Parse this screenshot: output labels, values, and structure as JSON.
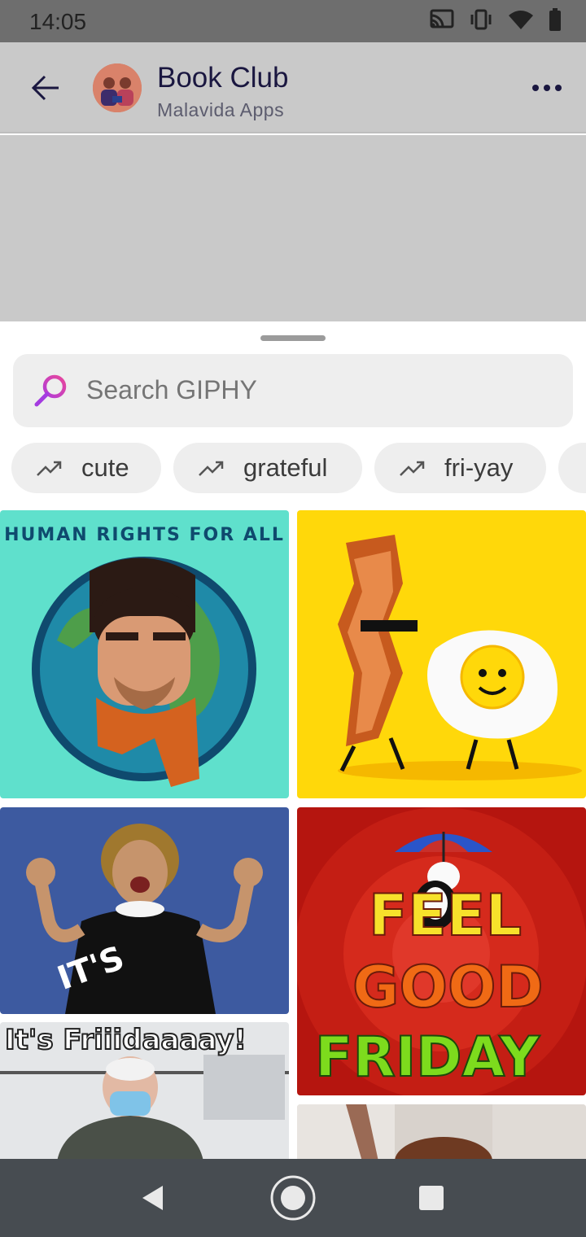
{
  "status_bar": {
    "time": "14:05",
    "icons": [
      "cast-icon",
      "vibrate-icon",
      "wifi-icon",
      "battery-icon"
    ]
  },
  "header": {
    "back_icon": "arrow-left-icon",
    "avatar": "group-avatar",
    "title": "Book Club",
    "subtitle": "Malavida Apps",
    "more_icon": "more-vertical-icon"
  },
  "giphy": {
    "search": {
      "placeholder": "Search GIPHY",
      "icon": "search-icon"
    },
    "trending_chips": [
      {
        "label": "cute",
        "icon": "trending-icon"
      },
      {
        "label": "grateful",
        "icon": "trending-icon"
      },
      {
        "label": "fri-yay",
        "icon": "trending-icon"
      }
    ],
    "gifs": [
      {
        "name": "human-rights-gif",
        "text": "HUMAN RIGHTS FOR ALL"
      },
      {
        "name": "bacon-egg-gif",
        "text": ""
      },
      {
        "name": "its-friday-woman-gif",
        "text": "IT'S"
      },
      {
        "name": "feel-good-friday-gif",
        "text_line1": "FEEL",
        "text_line2": "GOOD",
        "text_line3": "FRIDAY"
      },
      {
        "name": "its-friiidaaaay-gif",
        "text": "It's Friiidaaaay!"
      },
      {
        "name": "person-door-gif",
        "text": ""
      }
    ]
  },
  "nav": {
    "back": "nav-back-icon",
    "home": "nav-home-icon",
    "recents": "nav-recents-icon"
  },
  "colors": {
    "header_bg": "#c9c9c9",
    "title_color": "#1a1740",
    "chip_bg": "#eeeeee",
    "nav_bg": "#474c51"
  }
}
